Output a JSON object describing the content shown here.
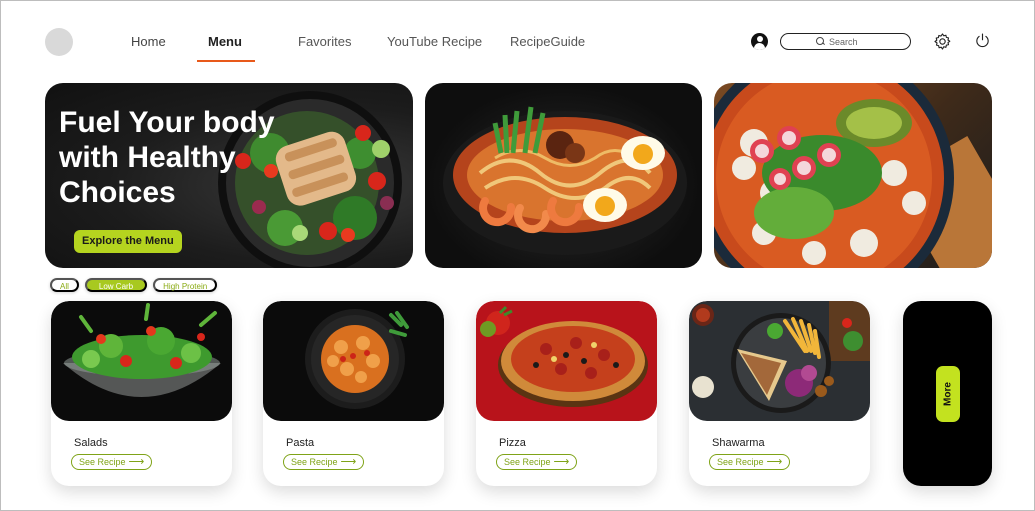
{
  "nav": {
    "items": [
      {
        "label": "Home"
      },
      {
        "label": "Menu"
      },
      {
        "label": "Favorites"
      },
      {
        "label": "YouTube Recipe"
      },
      {
        "label": "RecipeGuide"
      }
    ],
    "active": "Menu"
  },
  "search": {
    "placeholder": "Search",
    "icon": "search-icon"
  },
  "icons": {
    "user": "user-icon",
    "settings": "gear-icon",
    "power": "power-icon"
  },
  "hero": {
    "title": "Fuel Your body with Healthy Choices",
    "button_label": "Explore the Menu"
  },
  "filters": [
    {
      "label": "All",
      "active": false
    },
    {
      "label": "Low Carb",
      "active": true
    },
    {
      "label": "High Protein",
      "active": false
    }
  ],
  "cards": [
    {
      "title": "Salads",
      "cta": "See Recipe"
    },
    {
      "title": "Pasta",
      "cta": "See Recipe"
    },
    {
      "title": "Pizza",
      "cta": "See Recipe"
    },
    {
      "title": "Shawarma",
      "cta": "See Recipe"
    }
  ],
  "more": {
    "label": "More"
  },
  "colors": {
    "accent": "#b5d41f",
    "accent_text": "#7fa318",
    "active_nav_underline": "#e8591a",
    "dark": "#111111"
  }
}
